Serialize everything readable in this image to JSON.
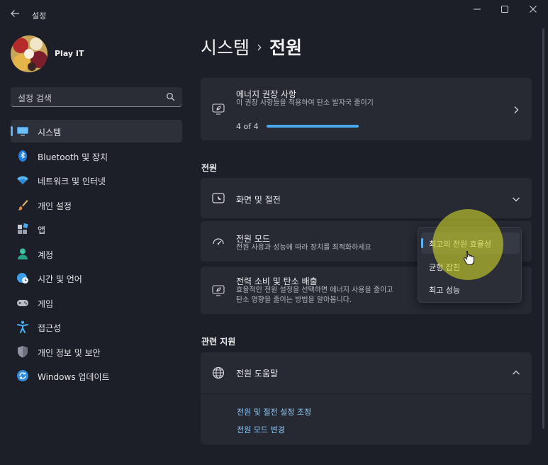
{
  "window": {
    "back_icon": "back-arrow-icon",
    "title": "설정",
    "minimize_icon": "minimize-icon",
    "maximize_icon": "maximize-icon",
    "close_icon": "close-icon"
  },
  "profile": {
    "name": "Play IT"
  },
  "search": {
    "placeholder": "설정 검색",
    "icon": "search-icon"
  },
  "sidebar": {
    "items": [
      {
        "label": "시스템",
        "icon": "monitor-icon",
        "active": true
      },
      {
        "label": "Bluetooth 및 장치",
        "icon": "bluetooth-icon"
      },
      {
        "label": "네트워크 및 인터넷",
        "icon": "wifi-icon"
      },
      {
        "label": "개인 설정",
        "icon": "paintbrush-icon"
      },
      {
        "label": "앱",
        "icon": "apps-icon"
      },
      {
        "label": "계정",
        "icon": "person-icon"
      },
      {
        "label": "시간 및 언어",
        "icon": "globe-clock-icon"
      },
      {
        "label": "게임",
        "icon": "gamepad-icon"
      },
      {
        "label": "접근성",
        "icon": "accessibility-icon"
      },
      {
        "label": "개인 정보 및 보안",
        "icon": "shield-icon"
      },
      {
        "label": "Windows 업데이트",
        "icon": "update-icon"
      }
    ]
  },
  "breadcrumb": {
    "parent": "시스템",
    "separator": "›",
    "current": "전원"
  },
  "energy_card": {
    "title": "에너지 권장 사항",
    "subtitle": "이 권장 사항들을 적용하여 탄소 발자국 줄이기",
    "progress_text": "4 of 4",
    "progress_value": 1.0,
    "icon": "leaf-icon",
    "chevron_icon": "chevron-right-icon"
  },
  "power_section": {
    "title": "전원",
    "screen_sleep": {
      "title": "화면 및 절전",
      "icon": "screen-sleep-icon",
      "chevron_icon": "chevron-down-icon"
    },
    "power_mode": {
      "title": "전원 모드",
      "subtitle": "전원 사용과 성능에 따라 장치를 최적화하세요",
      "icon": "power-gauge-icon",
      "options": [
        "최고의 전원 효율성",
        "균형 잡힌",
        "최고 성능"
      ],
      "selected": "최고의 전원 효율성"
    },
    "consumption": {
      "title": "전력 소비 및 탄소 배출",
      "subtitle_line1": "효율적인 전원 설정을 선택하면 에너지 사용을 줄이고",
      "subtitle_line2": "탄소 영향을 줄이는 방법을 알아봅니다.",
      "icon": "leaf-icon"
    }
  },
  "related_section": {
    "title": "관련 지원",
    "help": {
      "title": "전원 도움말",
      "icon": "globe-icon",
      "chevron_icon": "chevron-up-icon",
      "links": [
        "전원 및 절전 설정 조정",
        "전원 모드 변경"
      ]
    }
  },
  "colors": {
    "accent": "#5fb2f2",
    "link": "#8cc9f7",
    "highlight": "#cdd228"
  }
}
